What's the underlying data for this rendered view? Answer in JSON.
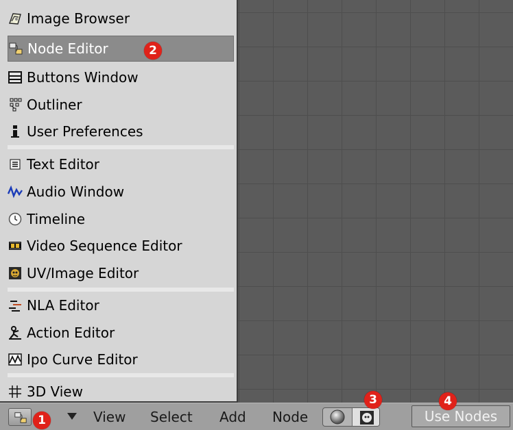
{
  "menu": {
    "items": [
      {
        "label": "Image Browser",
        "icon": "image-browser-icon"
      },
      {
        "label": "Node Editor",
        "icon": "node-editor-icon",
        "selected": true
      },
      {
        "label": "Buttons Window",
        "icon": "buttons-window-icon"
      },
      {
        "label": "Outliner",
        "icon": "outliner-icon"
      },
      {
        "label": "User Preferences",
        "icon": "user-preferences-icon"
      },
      {
        "label": "Text Editor",
        "icon": "text-editor-icon"
      },
      {
        "label": "Audio Window",
        "icon": "audio-window-icon"
      },
      {
        "label": "Timeline",
        "icon": "timeline-icon"
      },
      {
        "label": "Video Sequence Editor",
        "icon": "video-sequence-icon"
      },
      {
        "label": "UV/Image Editor",
        "icon": "uv-image-editor-icon"
      },
      {
        "label": "NLA Editor",
        "icon": "nla-editor-icon"
      },
      {
        "label": "Action Editor",
        "icon": "action-editor-icon"
      },
      {
        "label": "Ipo Curve Editor",
        "icon": "ipo-curve-editor-icon"
      },
      {
        "label": "3D View",
        "icon": "3d-view-icon"
      }
    ]
  },
  "header": {
    "view": "View",
    "select": "Select",
    "add": "Add",
    "node": "Node",
    "use_nodes": "Use Nodes"
  },
  "badges": {
    "b1": "1",
    "b2": "2",
    "b3": "3",
    "b4": "4"
  },
  "colors": {
    "badge": "#e0221a",
    "selected_row": "#8b8b8b",
    "canvas": "#5b5b5b"
  }
}
